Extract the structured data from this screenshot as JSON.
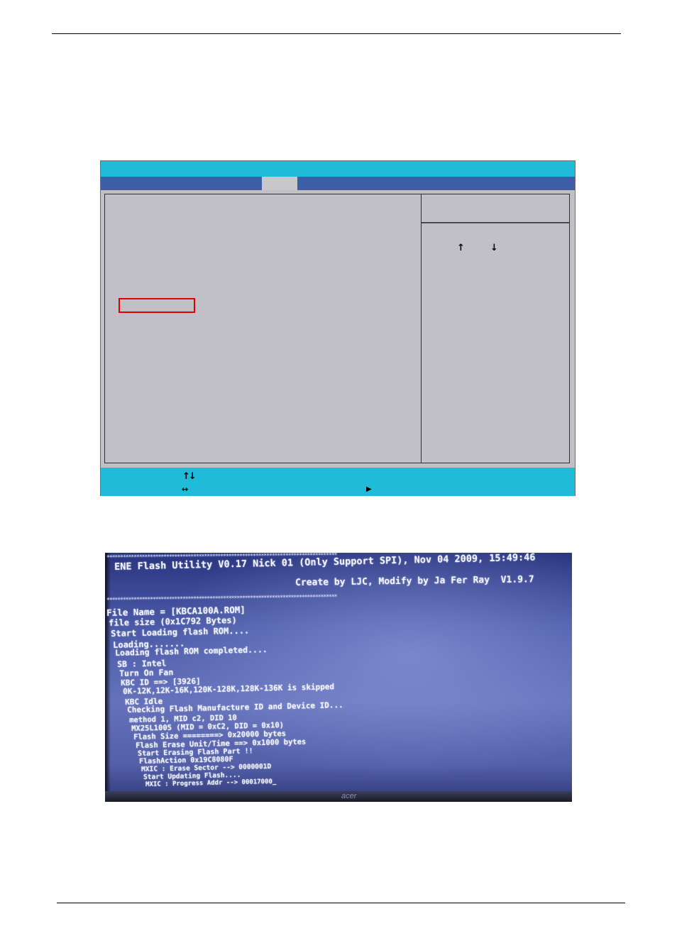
{
  "flash_screen": {
    "banner_stars_top": "*************************************************************************************",
    "title": "ENE Flash Utility V0.17 Nick 01 (Only Support SPI), Nov 04 2009, 15:49:46",
    "credit": "Create by LJC, Modify by Ja Fer Ray  V1.9.7",
    "banner_stars_bottom": "*************************************************************************************",
    "log_lines": [
      "File Name = [KBCA100A.ROM]",
      "file size (0x1C792 Bytes)",
      "Start Loading flash ROM....",
      "Loading.......",
      "Loading flash ROM completed....",
      "SB : Intel",
      "Turn On Fan",
      "KBC ID ==> [3926]",
      "0K-12K,12K-16K,120K-128K,128K-136K is skipped",
      "KBC Idle",
      "Checking Flash Manufacture ID and Device ID...",
      "method 1, MID c2, DID 10",
      "MX25L1005 (MID = 0xC2, DID = 0x10)",
      "Flash Size ========> 0x20000 bytes",
      "Flash Erase Unit/Time ==> 0x1000 bytes",
      "Start Erasing Flash Part !!",
      "FlashAction 0x19C8080F",
      "MXIC : Erase Sector --> 0000001D",
      "Start Updating Flash....",
      "MXIC : Progress Addr --> 00017000_"
    ],
    "bezel_logo": "acer"
  },
  "bios_screen": {
    "help_up_glyph": "↑",
    "help_down_glyph": "↓",
    "footer_updown_glyph": "↑↓",
    "footer_leftright_glyph": "↔",
    "footer_play_glyph": "▶"
  }
}
